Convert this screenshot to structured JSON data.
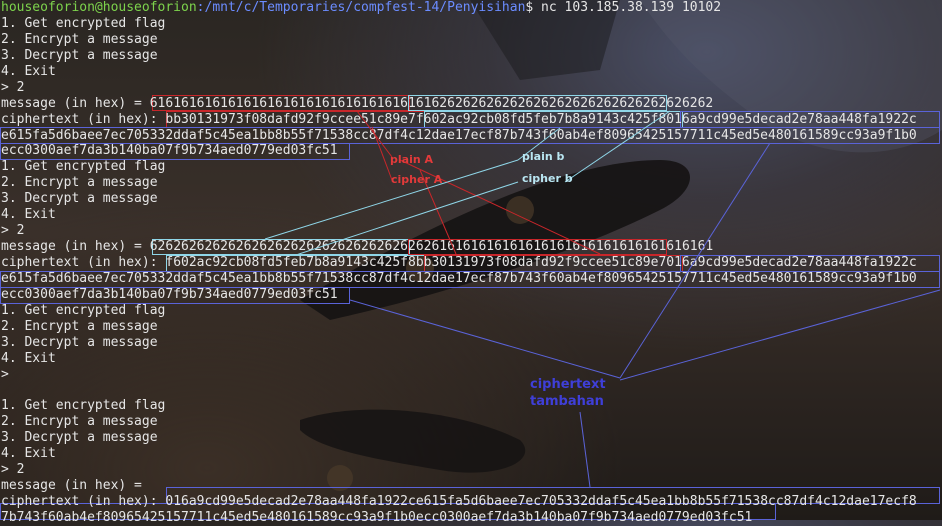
{
  "prompt": {
    "user": "houseoforion@houseoforion",
    "path": ":/mnt/c/Temporaries/compfest-14/Penyisihan",
    "command": "$ nc 103.185.38.139 10102"
  },
  "menu": [
    "1. Get encrypted flag",
    "2. Encrypt a message",
    "3. Decrypt a message",
    "4. Exit"
  ],
  "prompt_symbol": ">",
  "prompt_answer": "> 2",
  "message_label": "message (in hex) = ",
  "cipher_label": "ciphertext (in hex): ",
  "session1": {
    "msg_a": "616161616161616161616161616161616161",
    "msg_b": "626262626262626262626262626262626262",
    "ct_a": "bb30131973f08dafd92f9ccee51c89e7",
    "ct_b": "f602ac92cb08fd5feb7b8a9143c425f8",
    "ct_rest1": "016a9cd99e5decad2e78aa448fa1922c",
    "ct_line2": "e615fa5d6baee7ec705332ddaf5c45ea1bb8b55f71538cc87df4c12dae17ecf87b743f60ab4ef80965425157711c45ed5e480161589cc93a9f1b0",
    "ct_line3": "ecc0300aef7da3b140ba07f9b734aed0779ed03fc51"
  },
  "session2": {
    "msg_b": "626262626262626262626262626262626262",
    "msg_a": "616161616161616161616161616161616161",
    "ct_b": "f602ac92cb08fd5feb7b8a9143c425f8",
    "ct_a": "bb30131973f08dafd92f9ccee51c89e7",
    "ct_rest1": "016a9cd99e5decad2e78aa448fa1922c",
    "ct_line2": "e615fa5d6baee7ec705332ddaf5c45ea1bb8b55f71538cc87df4c12dae17ecf87b743f60ab4ef80965425157711c45ed5e480161589cc93a9f1b0",
    "ct_line3": "ecc0300aef7da3b140ba07f9b734aed0779ed03fc51"
  },
  "session3": {
    "ct_line1": "016a9cd99e5decad2e78aa448fa1922ce615fa5d6baee7ec705332ddaf5c45ea1bb8b55f71538cc87df4c12dae17ecf8",
    "ct_line2": "7b743f60ab4ef80965425157711c45ed5e480161589cc93a9f1b0ecc0300aef7da3b140ba07f9b734aed0779ed03fc51"
  },
  "annotations": {
    "plain_a": "plain A",
    "cipher_a": "cipher A",
    "plain_b": "plain b",
    "cipher_b": "cipher b",
    "cipher_extra_1": "ciphertext",
    "cipher_extra_2": "tambahan"
  },
  "colors": {
    "red_box": "#c8262a",
    "cyan_box": "#8fd6e8",
    "blue_box": "#5a63d8",
    "prompt_user": "#7dd34c",
    "prompt_path": "#6b8cff"
  }
}
